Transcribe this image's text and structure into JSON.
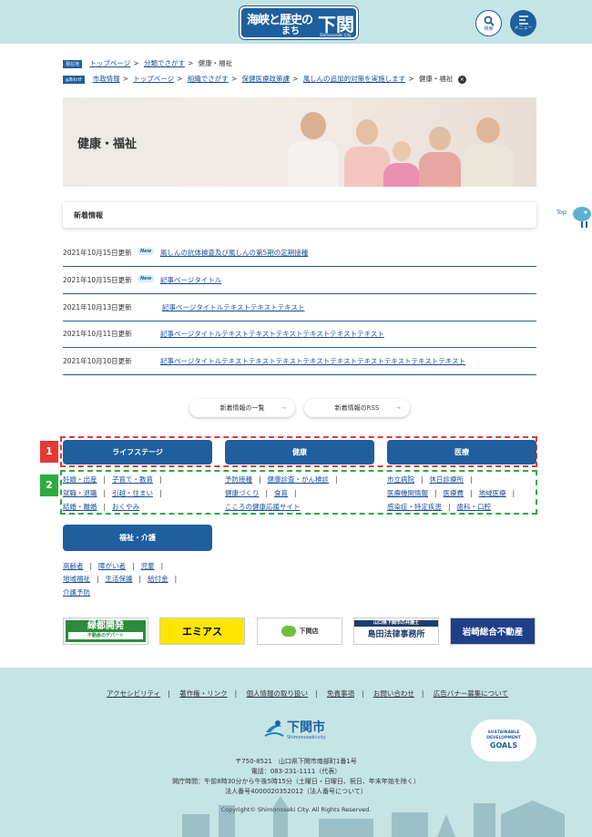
{
  "header": {
    "logo_line1": "海峡と歴史の",
    "logo_line2": "まち",
    "logo_big": "下関",
    "logo_sub": "Shimonoseki City",
    "search_label": "検索",
    "menu_label": "メニュー"
  },
  "breadcrumbs": {
    "row1_tag": "現在地",
    "row1": [
      "トップページ",
      "分類でさがす",
      "健康・福祉"
    ],
    "row2_tag": "gあわせ",
    "row2": [
      "市政情報",
      "トップページ",
      "組織でさがす",
      "保健医療政策課",
      "風しんの追加的対策を実施します",
      "健康・福祉"
    ]
  },
  "hero": {
    "title": "健康・福祉"
  },
  "news": {
    "heading": "新着情報",
    "new_badge": "New",
    "items": [
      {
        "date": "2021年10月15日更新",
        "title": "風しんの抗体検査及び風しんの第5期の定期接種",
        "is_new": true
      },
      {
        "date": "2021年10月15日更新",
        "title": "記事ページタイトル",
        "is_new": true
      },
      {
        "date": "2021年10月13日更新",
        "title": "記事ページタイトルテキストテキストテキスト",
        "is_new": false
      },
      {
        "date": "2021年10月11日更新",
        "title": "記事ページタイトルテキストテキストテキストテキストテキストテキスト",
        "is_new": false
      },
      {
        "date": "2021年10月10日更新",
        "title": "記事ページタイトルテキストテキストテキストテキストテキストテキストテキストテキストテキスト",
        "is_new": false
      }
    ],
    "list_button": "新着情報の一覧",
    "rss_button": "新着情報のRSS"
  },
  "top_button": "Top",
  "categories": {
    "tag1": "1",
    "tag2": "2",
    "buttons": [
      "ライフステージ",
      "健康",
      "医療"
    ],
    "col1": [
      [
        "妊娠・出産",
        "子育て・教育"
      ],
      [
        "就職・退職",
        "引越・住まい"
      ],
      [
        "結婚・離婚",
        "おくやみ"
      ]
    ],
    "col2": [
      [
        "予防接種",
        "健康診査・がん検診"
      ],
      [
        "健康づくり",
        "食育"
      ],
      [
        "こころの健康応援サイト"
      ]
    ],
    "col3": [
      [
        "市立病院",
        "休日診療所"
      ],
      [
        "医療機関情報",
        "医療費",
        "地域医療"
      ],
      [
        "感染症・特定疾患",
        "歯科・口腔"
      ]
    ],
    "welfare_button": "福祉・介護",
    "welfare_links": [
      [
        "高齢者",
        "障がい者",
        "児童"
      ],
      [
        "地域福祉",
        "生活保護",
        "給付金"
      ],
      [
        "介護予防"
      ]
    ]
  },
  "banners": {
    "b1": "緑都開発",
    "b1_sub": "不動産のデパート",
    "b2": "エミアス",
    "b3": "下関店",
    "b4_top": "山口県下関市の弁護士",
    "b4": "島田法律事務所",
    "b5": "岩崎総合不動産"
  },
  "footer": {
    "links": [
      "アクセシビリティ",
      "著作権・リンク",
      "個人情報の取り扱い",
      "免責事項",
      "お問い合わせ",
      "広告バナー募集について"
    ],
    "city_name": "下関市",
    "city_sub": "Shimonoseki-city",
    "sdg_line1": "SUSTAINABLE",
    "sdg_line2": "DEVELOPMENT",
    "sdg_line3": "GOALS",
    "address": "〒750-8521　山口県下関市南部町1番1号",
    "phone": "電話：083-231-1111（代表）",
    "hours": "開庁時間：午前8時30分から午後5時15分（土曜日・日曜日、祝日、年末年始を除く）",
    "corp_no": "法人番号4000020352012（法人番号について）",
    "copyright": "Copyright© Shimonoseki City. All Rights Reserved."
  },
  "colors": {
    "primary": "#1f5f9e",
    "header_bg": "#c5e4e6",
    "red_dash": "#e53935",
    "green_dash": "#2eaa3f"
  }
}
